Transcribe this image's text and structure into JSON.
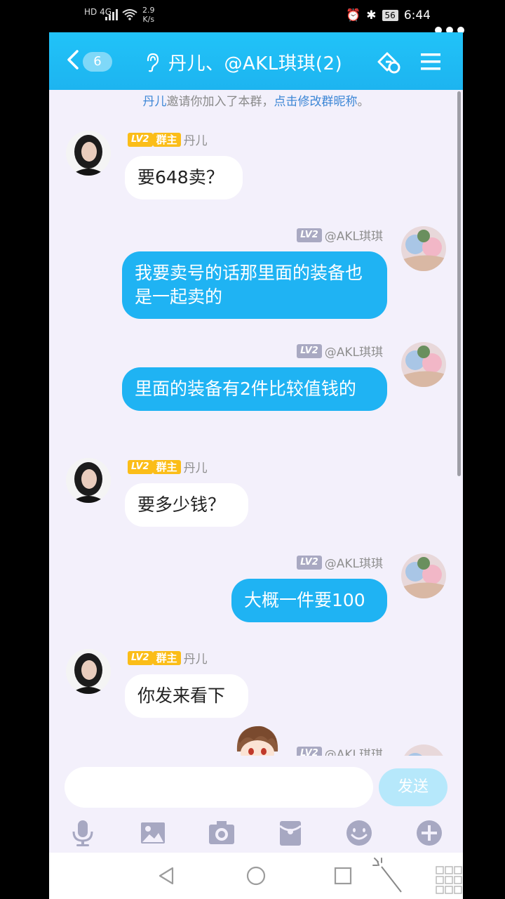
{
  "status_bar": {
    "network": "HD 4G",
    "speed_value": "2.9",
    "speed_unit": "K/s",
    "battery": "56",
    "time": "6:44"
  },
  "header": {
    "unread_count": "6",
    "title": "丹儿、@AKL琪琪(2)"
  },
  "system_note": {
    "name": "丹儿",
    "text": "邀请你加入了本群，",
    "link": "点击修改群昵称",
    "end": "。"
  },
  "badges": {
    "level": "LV2",
    "owner": "群主"
  },
  "messages": [
    {
      "sender": "丹儿",
      "side": "left",
      "owner": true,
      "text": "要648卖？"
    },
    {
      "sender": "@AKL琪琪",
      "side": "right",
      "owner": false,
      "text": "我要卖号的话那里面的装备也是一起卖的"
    },
    {
      "sender": "@AKL琪琪",
      "side": "right",
      "owner": false,
      "text": "里面的装备有2件比较值钱的"
    },
    {
      "sender": "丹儿",
      "side": "left",
      "owner": true,
      "text": "要多少钱？"
    },
    {
      "sender": "@AKL琪琪",
      "side": "right",
      "owner": false,
      "text": "大概一件要100"
    },
    {
      "sender": "丹儿",
      "side": "left",
      "owner": true,
      "text": "你发来看下"
    },
    {
      "sender": "@AKL琪琪",
      "side": "right",
      "owner": false,
      "text": ""
    }
  ],
  "input": {
    "placeholder": "",
    "send_label": "发送"
  },
  "toolbar_icons": [
    "microphone-icon",
    "image-icon",
    "camera-icon",
    "red-packet-icon",
    "emoji-icon",
    "plus-icon"
  ],
  "colors": {
    "header": "#1db4f0",
    "bubble_right": "#1fb3f3",
    "bubble_left": "#ffffff",
    "chat_bg": "#f3f0fb",
    "owner_badge": "#fbbd18",
    "level_badge": "#a9a9c2"
  }
}
